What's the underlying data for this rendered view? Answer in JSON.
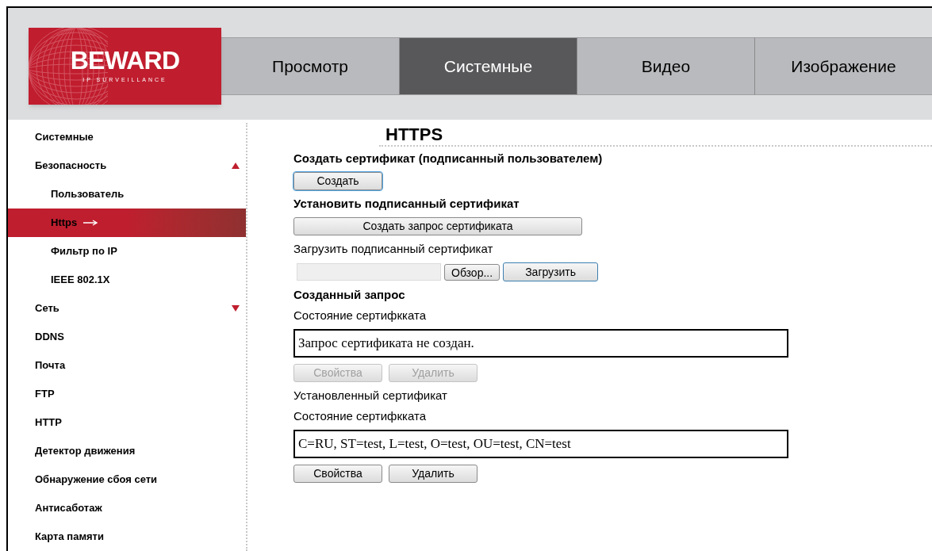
{
  "logo": {
    "name": "BEWARD",
    "tagline": "IP SURVEILLANCE"
  },
  "tabs": [
    {
      "label": "Просмотр",
      "selected": false
    },
    {
      "label": "Системные",
      "selected": true
    },
    {
      "label": "Видео",
      "selected": false
    },
    {
      "label": "Изображение",
      "selected": false
    }
  ],
  "sidebar": {
    "items": [
      {
        "label": "Системные",
        "selected": false
      },
      {
        "label": "Безопасность",
        "selected": false,
        "expanded": true,
        "children": [
          {
            "label": "Пользователь",
            "selected": false
          },
          {
            "label": "Https",
            "selected": true
          },
          {
            "label": "Фильтр по IP",
            "selected": false
          },
          {
            "label": "IEEE 802.1X",
            "selected": false
          }
        ]
      },
      {
        "label": "Сеть",
        "selected": false,
        "expanded": false
      },
      {
        "label": "DDNS",
        "selected": false
      },
      {
        "label": "Почта",
        "selected": false
      },
      {
        "label": "FTP",
        "selected": false
      },
      {
        "label": "HTTP",
        "selected": false
      },
      {
        "label": "Детектор движения",
        "selected": false
      },
      {
        "label": "Обнаружение сбоя сети",
        "selected": false
      },
      {
        "label": "Антисаботаж",
        "selected": false
      },
      {
        "label": "Карта памяти",
        "selected": false
      }
    ]
  },
  "page_title": "HTTPS",
  "content": [
    {
      "kind": "heading",
      "text": "Создать сертификат (подписанный пользователем)"
    },
    {
      "kind": "buttons",
      "buttons": [
        {
          "label": "Создать",
          "disabled": false,
          "focused": true
        }
      ]
    },
    {
      "kind": "heading",
      "text": "Установить подписанный сертификат"
    },
    {
      "kind": "wide_button",
      "label": "Создать запрос сертификата",
      "disabled": false,
      "focused": false
    },
    {
      "kind": "label",
      "text": "Загрузить подписанный сертификат"
    },
    {
      "kind": "upload",
      "browse": "Обзор...",
      "upload": "Загрузить"
    },
    {
      "kind": "heading",
      "text": "Созданный запрос"
    },
    {
      "kind": "label",
      "text": "Состояние сертифкката"
    },
    {
      "kind": "status",
      "text": "Запрос сертификата не создан."
    },
    {
      "kind": "buttons",
      "buttons": [
        {
          "label": "Свойства",
          "disabled": true,
          "focused": false
        },
        {
          "label": "Удалить",
          "disabled": true,
          "focused": false
        }
      ]
    },
    {
      "kind": "label",
      "text": "Установленный сертификат"
    },
    {
      "kind": "label",
      "text": "Состояние сертифкката"
    },
    {
      "kind": "status",
      "text": "C=RU, ST=test, L=test, O=test, OU=test, CN=test"
    },
    {
      "kind": "buttons",
      "buttons": [
        {
          "label": "Свойства",
          "disabled": false,
          "focused": false
        },
        {
          "label": "Удалить",
          "disabled": false,
          "focused": false
        }
      ]
    }
  ]
}
